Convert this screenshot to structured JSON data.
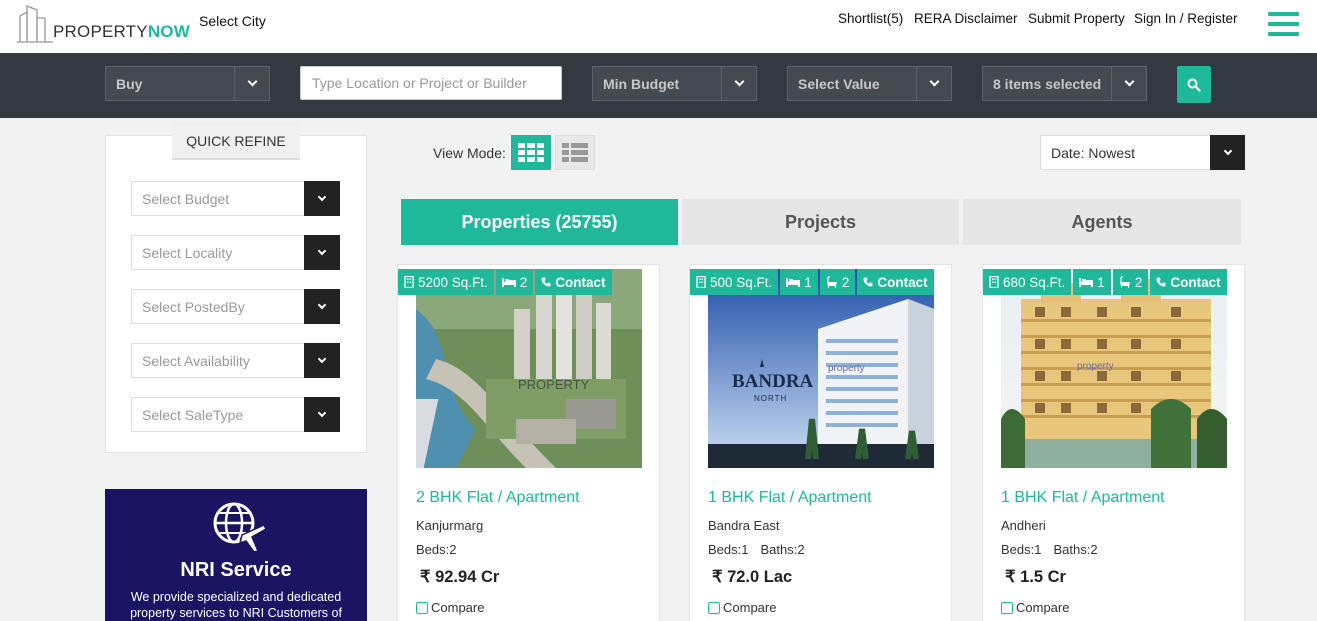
{
  "header": {
    "logo": {
      "part1": "PROPERTY",
      "part2": "NOW"
    },
    "select_city": "Select City",
    "links": {
      "shortlist": "Shortlist(5)",
      "rera": "RERA Disclaimer",
      "submit": "Submit Property",
      "signin": "Sign In / Register"
    },
    "menu_icon": "hamburger-menu-icon"
  },
  "search": {
    "type_value": "Buy",
    "location_placeholder": "Type Location or Project or Builder",
    "min_budget": "Min Budget",
    "max_budget": "Select Value",
    "property_types": "8 items selected",
    "search_icon": "search-icon"
  },
  "sidebar": {
    "title": "QUICK REFINE",
    "filters": [
      "Select Budget",
      "Select Locality",
      "Select PostedBy",
      "Select Availability",
      "Select SaleType"
    ],
    "nri": {
      "title": "NRI Service",
      "description": "We provide specialized and dedicated property services to NRI Customers of"
    }
  },
  "toolbar": {
    "view_mode_label": "View Mode:",
    "sort_value": "Date: Nowest"
  },
  "tabs": [
    {
      "label": "Properties (25755)"
    },
    {
      "label": "Projects"
    },
    {
      "label": "Agents"
    }
  ],
  "cards": [
    {
      "area": "5200 Sq.Ft.",
      "beds_badge": "2",
      "baths_badge": "",
      "contact": "Contact",
      "title": "2 BHK Flat / Apartment",
      "locality": "Kanjurmarg",
      "beds": "Beds:2",
      "baths": "",
      "price": "₹ 92.94 Cr",
      "compare": "Compare",
      "watermark": "PROPERTY"
    },
    {
      "area": "500 Sq.Ft.",
      "beds_badge": "1",
      "baths_badge": "2",
      "contact": "Contact",
      "title": "1 BHK Flat / Apartment",
      "locality": "Bandra East",
      "beds": "Beds:1",
      "baths": "Baths:2",
      "price": "₹ 72.0 Lac",
      "compare": "Compare",
      "brand_text": "BANDRA",
      "brand_sub": "NORTH",
      "watermark": "property"
    },
    {
      "area": "680 Sq.Ft.",
      "beds_badge": "1",
      "baths_badge": "2",
      "contact": "Contact",
      "title": "1 BHK Flat / Apartment",
      "locality": "Andheri",
      "beds": "Beds:1",
      "baths": "Baths:2",
      "price": "₹ 1.5 Cr",
      "compare": "Compare",
      "watermark": "property"
    }
  ],
  "colors": {
    "accent": "#1fb89a",
    "searchbar_bg": "#333a3f",
    "nri_bg": "#1b1463"
  }
}
